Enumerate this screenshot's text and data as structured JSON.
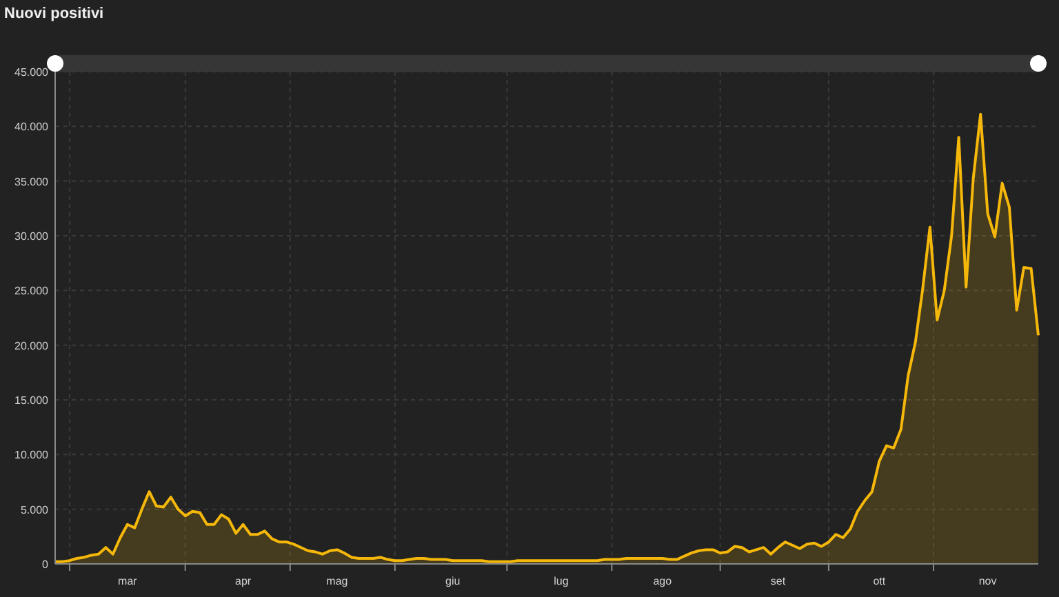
{
  "chart_data": {
    "type": "area",
    "title": "Nuovi positivi",
    "grid": true,
    "categories": [
      null,
      null,
      null,
      null,
      null,
      null,
      null,
      null,
      null,
      null,
      "mar",
      null,
      null,
      null,
      null,
      null,
      null,
      null,
      null,
      null,
      null,
      null,
      null,
      null,
      null,
      null,
      "apr",
      null,
      null,
      null,
      null,
      null,
      null,
      null,
      null,
      null,
      null,
      null,
      null,
      "mag",
      null,
      null,
      null,
      null,
      null,
      null,
      null,
      null,
      null,
      null,
      null,
      null,
      null,
      null,
      null,
      "giu",
      null,
      null,
      null,
      null,
      null,
      null,
      null,
      null,
      null,
      null,
      null,
      null,
      null,
      null,
      "lug",
      null,
      null,
      null,
      null,
      null,
      null,
      null,
      null,
      null,
      null,
      null,
      null,
      null,
      "ago",
      null,
      null,
      null,
      null,
      null,
      null,
      null,
      null,
      null,
      null,
      null,
      null,
      null,
      null,
      null,
      "set",
      null,
      null,
      null,
      null,
      null,
      null,
      null,
      null,
      null,
      null,
      null,
      null,
      null,
      "ott",
      null,
      null,
      null,
      null,
      null,
      null,
      null,
      null,
      null,
      null,
      null,
      null,
      null,
      null,
      "nov",
      null,
      null,
      null,
      null,
      null,
      null,
      null
    ],
    "series": [
      {
        "color": "#f5b80a",
        "values": [
          200,
          200,
          300,
          500,
          600,
          800,
          900,
          1500,
          900,
          2400,
          3600,
          3300,
          5000,
          6600,
          5300,
          5200,
          6100,
          5000,
          4400,
          4800,
          4700,
          3600,
          3600,
          4500,
          4100,
          2800,
          3600,
          2700,
          2700,
          3000,
          2300,
          2000,
          2000,
          1800,
          1500,
          1200,
          1100,
          900,
          1200,
          1300,
          1000,
          600,
          500,
          500,
          500,
          600,
          400,
          300,
          300,
          400,
          500,
          500,
          400,
          400,
          400,
          300,
          300,
          300,
          300,
          300,
          200,
          200,
          200,
          200,
          300,
          300,
          300,
          300,
          300,
          300,
          300,
          300,
          300,
          300,
          300,
          300,
          400,
          400,
          400,
          500,
          500,
          500,
          500,
          500,
          500,
          400,
          400,
          700,
          1000,
          1200,
          1300,
          1300,
          1000,
          1100,
          1600,
          1500,
          1100,
          1300,
          1500,
          900,
          1500,
          2000,
          1700,
          1400,
          1800,
          1900,
          1600,
          2000,
          2700,
          2400,
          3200,
          4800,
          5800,
          6600,
          9400,
          10800,
          10600,
          12300,
          17200,
          20300,
          25100,
          30800,
          22300,
          25000,
          30000,
          39000,
          25300,
          35200,
          41100,
          32000,
          29900,
          34800,
          32600,
          23200,
          27100,
          27000,
          20900
        ]
      }
    ],
    "ylim": [
      0,
      45000
    ],
    "yticks": [
      {
        "value": 0,
        "label": "0"
      },
      {
        "value": 5000,
        "label": "5.000"
      },
      {
        "value": 10000,
        "label": "10.000"
      },
      {
        "value": 15000,
        "label": "15.000"
      },
      {
        "value": 20000,
        "label": "20.000"
      },
      {
        "value": 25000,
        "label": "25.000"
      },
      {
        "value": 30000,
        "label": "30.000"
      },
      {
        "value": 35000,
        "label": "35.000"
      },
      {
        "value": 40000,
        "label": "40.000"
      },
      {
        "value": 45000,
        "label": "45.000"
      }
    ]
  },
  "range_handles": [
    {
      "level": 0
    },
    {
      "level": 1
    }
  ]
}
